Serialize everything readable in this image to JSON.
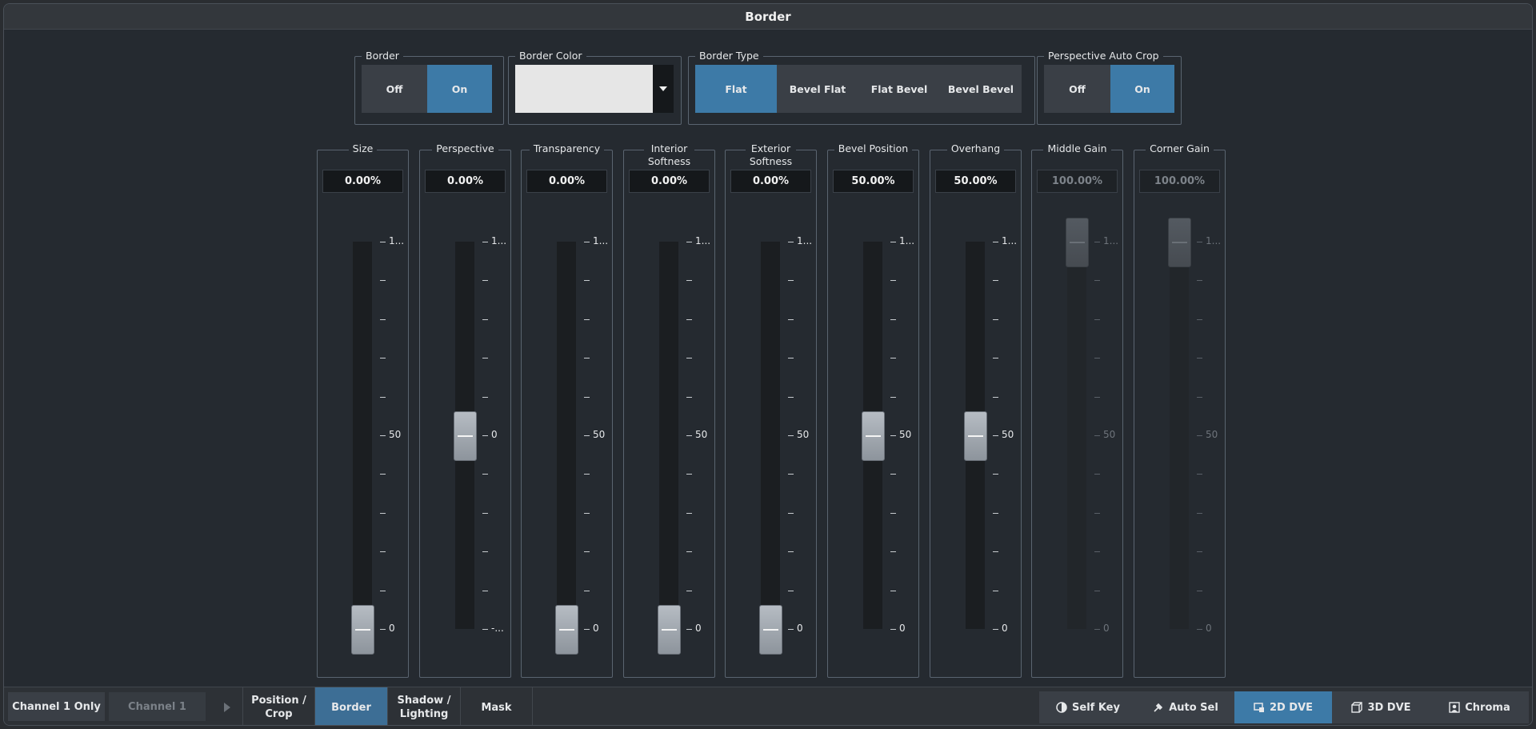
{
  "window": {
    "title": "Border"
  },
  "border": {
    "label": "Border",
    "options": [
      "Off",
      "On"
    ],
    "selected": "On"
  },
  "border_color": {
    "label": "Border Color",
    "value": "#e6e6e6"
  },
  "border_type": {
    "label": "Border Type",
    "options": [
      "Flat",
      "Bevel Flat",
      "Flat Bevel",
      "Bevel Bevel"
    ],
    "selected": "Flat"
  },
  "perspective_auto_crop": {
    "label": "Perspective Auto Crop",
    "options": [
      "Off",
      "On"
    ],
    "selected": "On"
  },
  "sliders": [
    {
      "label": "Size",
      "value": "0.00%",
      "ticks": [
        "1...",
        "50",
        "0"
      ],
      "level": 0,
      "disabled": false
    },
    {
      "label": "Perspective",
      "value": "0.00%",
      "ticks": [
        "1...",
        "0",
        "-..."
      ],
      "level": 0.5,
      "disabled": false
    },
    {
      "label": "Transparency",
      "value": "0.00%",
      "ticks": [
        "1...",
        "50",
        "0"
      ],
      "level": 0,
      "disabled": false
    },
    {
      "label": "Interior\nSoftness",
      "value": "0.00%",
      "ticks": [
        "1...",
        "50",
        "0"
      ],
      "level": 0,
      "disabled": false
    },
    {
      "label": "Exterior\nSoftness",
      "value": "0.00%",
      "ticks": [
        "1...",
        "50",
        "0"
      ],
      "level": 0,
      "disabled": false
    },
    {
      "label": "Bevel Position",
      "value": "50.00%",
      "ticks": [
        "1...",
        "50",
        "0"
      ],
      "level": 0.5,
      "disabled": false
    },
    {
      "label": "Overhang",
      "value": "50.00%",
      "ticks": [
        "1...",
        "50",
        "0"
      ],
      "level": 0.5,
      "disabled": false
    },
    {
      "label": "Middle Gain",
      "value": "100.00%",
      "ticks": [
        "1...",
        "50",
        "0"
      ],
      "level": 1,
      "disabled": true
    },
    {
      "label": "Corner Gain",
      "value": "100.00%",
      "ticks": [
        "1...",
        "50",
        "0"
      ],
      "level": 1,
      "disabled": true
    }
  ],
  "bottom": {
    "channel_only": "Channel 1 Only",
    "channel": "Channel 1",
    "tabs": [
      "Position /\nCrop",
      "Border",
      "Shadow /\nLighting",
      "Mask"
    ],
    "active_tab": "Border",
    "modes": [
      {
        "label": "Self Key",
        "icon": "self-key-icon"
      },
      {
        "label": "Auto Sel",
        "icon": "auto-select-icon"
      },
      {
        "label": "2D DVE",
        "icon": "2d-dve-icon"
      },
      {
        "label": "3D DVE",
        "icon": "3d-dve-icon"
      },
      {
        "label": "Chroma",
        "icon": "chroma-icon"
      }
    ],
    "active_mode": "2D DVE"
  },
  "colors": {
    "accent": "#3d7aa7",
    "background": "#252a30"
  }
}
